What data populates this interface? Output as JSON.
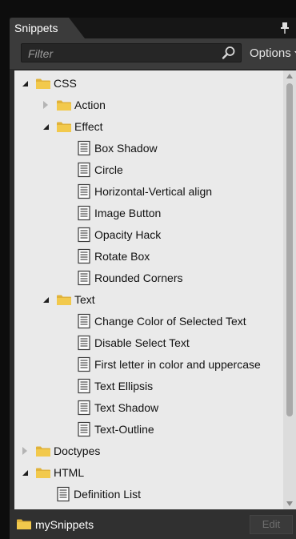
{
  "panel": {
    "tab_label": "Snippets",
    "filter": {
      "value": "",
      "placeholder": "Filter"
    },
    "options_label": "Options"
  },
  "tree": {
    "items": [
      {
        "label": "CSS",
        "type": "folder",
        "depth": 0,
        "expanded": true
      },
      {
        "label": "Action",
        "type": "folder",
        "depth": 1,
        "expanded": false
      },
      {
        "label": "Effect",
        "type": "folder",
        "depth": 1,
        "expanded": true
      },
      {
        "label": "Box Shadow",
        "type": "snippet",
        "depth": 2
      },
      {
        "label": "Circle",
        "type": "snippet",
        "depth": 2
      },
      {
        "label": "Horizontal-Vertical align",
        "type": "snippet",
        "depth": 2
      },
      {
        "label": "Image Button",
        "type": "snippet",
        "depth": 2
      },
      {
        "label": "Opacity Hack",
        "type": "snippet",
        "depth": 2
      },
      {
        "label": "Rotate Box",
        "type": "snippet",
        "depth": 2
      },
      {
        "label": "Rounded Corners",
        "type": "snippet",
        "depth": 2
      },
      {
        "label": "Text",
        "type": "folder",
        "depth": 1,
        "expanded": true
      },
      {
        "label": "Change Color of Selected Text",
        "type": "snippet",
        "depth": 2
      },
      {
        "label": "Disable Select Text",
        "type": "snippet",
        "depth": 2
      },
      {
        "label": "First letter in color and uppercase",
        "type": "snippet",
        "depth": 2
      },
      {
        "label": "Text Ellipsis",
        "type": "snippet",
        "depth": 2
      },
      {
        "label": "Text Shadow",
        "type": "snippet",
        "depth": 2
      },
      {
        "label": "Text-Outline",
        "type": "snippet",
        "depth": 2
      },
      {
        "label": "Doctypes",
        "type": "folder",
        "depth": 0,
        "expanded": false
      },
      {
        "label": "HTML",
        "type": "folder",
        "depth": 0,
        "expanded": true
      },
      {
        "label": "Definition List",
        "type": "snippet",
        "depth": 1
      }
    ]
  },
  "footer": {
    "folder_label": "mySnippets",
    "edit_label": "Edit"
  },
  "colors": {
    "folder": "#f2c94c",
    "panel_bg": "#2b2b2b",
    "tree_bg": "#eaeaea"
  }
}
